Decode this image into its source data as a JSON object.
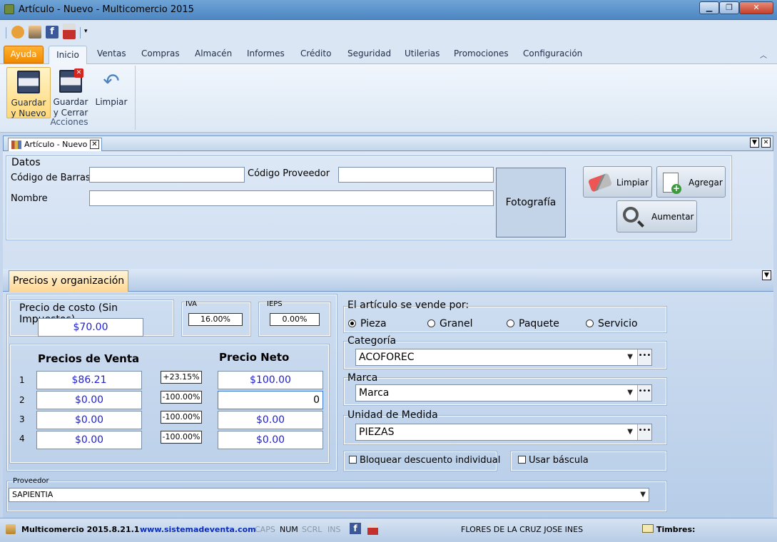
{
  "window": {
    "title": "Artículo - Nuevo - Multicomercio 2015",
    "minimize": "▁",
    "maximize": "❐",
    "close": "✕"
  },
  "ribbon_tabs": {
    "help": "Ayuda",
    "items": [
      "Inicio",
      "Ventas",
      "Compras",
      "Almacén",
      "Informes",
      "Crédito",
      "Seguridad",
      "Utilerias",
      "Promociones",
      "Configuración"
    ]
  },
  "ribbon": {
    "save_new": "Guardar\ny Nuevo",
    "save_new_l1": "Guardar",
    "save_new_l2": "y Nuevo",
    "save_close_l1": "Guardar",
    "save_close_l2": "y Cerrar",
    "clear": "Limpiar",
    "group": "Acciones"
  },
  "doc_tab": {
    "label": "Artículo - Nuevo"
  },
  "datos": {
    "legend": "Datos",
    "barcode_label": "Código de Barras",
    "barcode_value": "",
    "supplier_code_label": "Código Proveedor",
    "supplier_code_value": "",
    "name_label": "Nombre",
    "name_value": "",
    "photo_label": "Fotografía",
    "clear_button": "Limpiar",
    "add_button": "Agregar",
    "zoom_button": "Aumentar"
  },
  "precios": {
    "section_tab": "Precios y organización",
    "cost_label": "Precio de costo (Sin Impuestos)",
    "cost_value": "$70.00",
    "iva_label": "IVA",
    "iva_value": "16.00%",
    "ieps_label": "IEPS",
    "ieps_value": "0.00%",
    "sale_header": "Precios de Venta",
    "net_header": "Precio Neto",
    "rows": [
      {
        "n": "1",
        "sale": "$86.21",
        "pct": "+23.15%",
        "net": "$100.00"
      },
      {
        "n": "2",
        "sale": "$0.00",
        "pct": "-100.00%",
        "net": "0"
      },
      {
        "n": "3",
        "sale": "$0.00",
        "pct": "-100.00%",
        "net": "$0.00"
      },
      {
        "n": "4",
        "sale": "$0.00",
        "pct": "-100.00%",
        "net": "$0.00"
      }
    ]
  },
  "sell_by": {
    "label": "El artículo se vende por:",
    "options": [
      "Pieza",
      "Granel",
      "Paquete",
      "Servicio"
    ],
    "selected": "Pieza"
  },
  "category": {
    "label": "Categoría",
    "value": "ACOFOREC"
  },
  "brand": {
    "label": "Marca",
    "value": "Marca"
  },
  "unit": {
    "label": "Unidad de Medida",
    "value": "PIEZAS"
  },
  "checks": {
    "block_discount": "Bloquear descuento individual",
    "use_scale": "Usar báscula"
  },
  "supplier": {
    "label": "Proveedor",
    "value": "SAPIENTIA"
  },
  "status": {
    "version": "Multicomercio 2015.8.21.1",
    "site": "www.sistemadeventa.com",
    "caps": "CAPS",
    "num": "NUM",
    "scrl": "SCRL",
    "ins": "INS",
    "user": "FLORES DE LA CRUZ JOSE INES",
    "stamps": "Timbres:"
  }
}
